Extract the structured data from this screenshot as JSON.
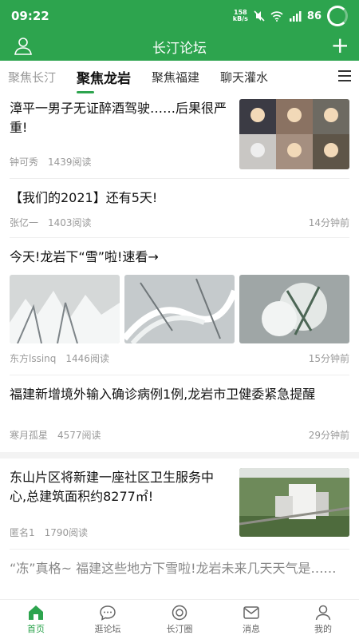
{
  "status_bar": {
    "time": "09:22",
    "speed": "158\nkB/s",
    "battery": "86"
  },
  "header": {
    "title": "长汀论坛",
    "left_icon": "user-icon",
    "right_icon": "plus-icon",
    "right_glyph": "+"
  },
  "tabs": [
    {
      "label": "聚焦长汀"
    },
    {
      "label": "聚焦龙岩"
    },
    {
      "label": "聚焦福建"
    },
    {
      "label": "聊天灌水"
    }
  ],
  "active_tab_index": 1,
  "articles": [
    {
      "title": "漳平一男子无证醉酒驾驶……后果很严重!",
      "author": "钟可秀",
      "reads": "1439阅读",
      "time": ""
    },
    {
      "title": "【我们的2021】还有5天!",
      "author": "张亿一",
      "reads": "1403阅读",
      "time": "14分钟前"
    },
    {
      "title": "今天!龙岩下“雪”啦!速看→",
      "author": "东方lssinq",
      "reads": "1446阅读",
      "time": "15分钟前"
    },
    {
      "title": "福建新增境外输入确诊病例1例,龙岩市卫健委紧急提醒",
      "author": "寒月孤星",
      "reads": "4577阅读",
      "time": "29分钟前"
    },
    {
      "title": "东山片区将新建一座社区卫生服务中心,总建筑面积约8277㎡!",
      "author": "匿名1",
      "reads": "1790阅读",
      "time": ""
    },
    {
      "title": "“冻”真格~ 福建这些地方下雪啦!龙岩未来几天天气是……",
      "author": "",
      "reads": "",
      "time": ""
    }
  ],
  "bottom_nav": [
    {
      "label": "首页",
      "icon": "home-icon"
    },
    {
      "label": "逛论坛",
      "icon": "chat-icon"
    },
    {
      "label": "长汀圈",
      "icon": "circle-icon"
    },
    {
      "label": "消息",
      "icon": "mail-icon"
    },
    {
      "label": "我的",
      "icon": "user-icon"
    }
  ],
  "colors": {
    "accent": "#2da44e",
    "text": "#111111",
    "meta": "#999999"
  }
}
